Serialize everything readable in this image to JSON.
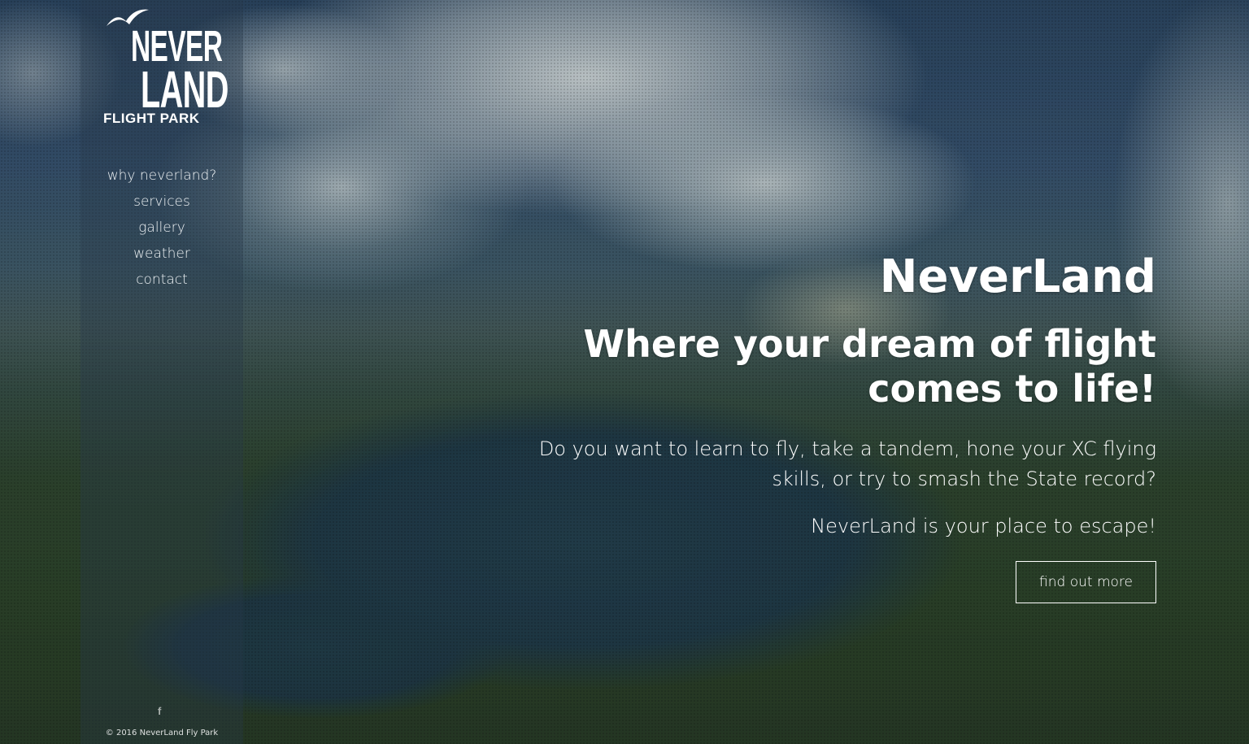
{
  "logo": {
    "line1": "NEVER",
    "line2": "LAND",
    "line3": "FLIGHT PARK"
  },
  "nav": {
    "items": [
      {
        "label": "why neverland?"
      },
      {
        "label": "services"
      },
      {
        "label": "gallery"
      },
      {
        "label": "weather"
      },
      {
        "label": "contact"
      }
    ]
  },
  "hero": {
    "title": "NeverLand",
    "tagline_line1": "Where your dream of flight",
    "tagline_line2": "comes to life!",
    "description_line1": "Do you want to learn to fly, take a tandem, hone your XC flying",
    "description_line2": "skills, or try to smash the State record?",
    "escape": "NeverLand is your place to escape!",
    "cta_label": "find out more"
  },
  "footer": {
    "social_icon": "facebook-icon",
    "social_glyph": "f",
    "copyright": "© 2016 NeverLand Fly Park"
  },
  "colors": {
    "text": "#ffffff",
    "sidebar_overlay": "rgba(40,58,74,0.35)"
  }
}
